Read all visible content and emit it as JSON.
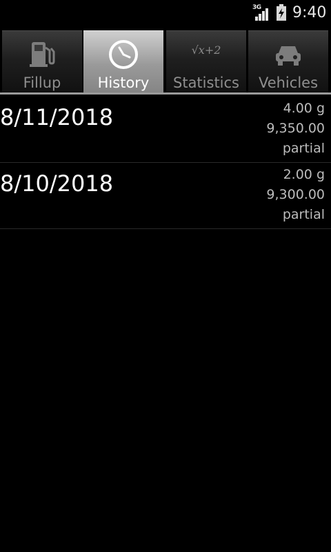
{
  "status_bar": {
    "network": "3G",
    "time": "9:40",
    "icons": [
      "signal-icon",
      "battery-charging-icon"
    ]
  },
  "tabs": [
    {
      "label": "Fillup",
      "icon": "fuel-pump-icon",
      "selected": false
    },
    {
      "label": "History",
      "icon": "clock-icon",
      "selected": true
    },
    {
      "label": "Statistics",
      "icon": "formula-icon",
      "icon_text": "√x+2",
      "selected": false
    },
    {
      "label": "Vehicles",
      "icon": "car-icon",
      "selected": false
    }
  ],
  "history": [
    {
      "date": "8/11/2018",
      "amount": "4.00 g",
      "odometer": "9,350.00",
      "type": "partial"
    },
    {
      "date": "8/10/2018",
      "amount": "2.00 g",
      "odometer": "9,300.00",
      "type": "partial"
    }
  ],
  "colors": {
    "background": "#000000",
    "selected_tab": "#9a9a9a",
    "primary_text": "#ffffff",
    "secondary_text": "#bcbcbc"
  }
}
